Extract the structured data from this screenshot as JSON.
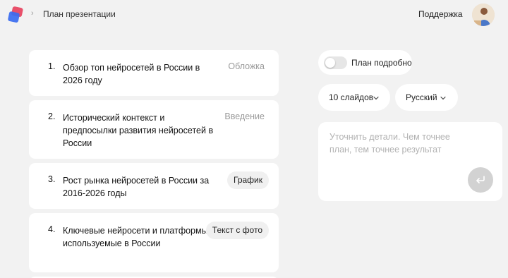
{
  "header": {
    "breadcrumb_separator": "›",
    "breadcrumb_title": "План презентации",
    "support_label": "Поддержка"
  },
  "slides": [
    {
      "number": "1.",
      "title": "Обзор топ нейросетей в России в 2026 году",
      "type": "Обложка",
      "type_style": "text"
    },
    {
      "number": "2.",
      "title": "Исторический контекст и предпосылки развития нейросетей в России",
      "type": "Введение",
      "type_style": "text"
    },
    {
      "number": "3.",
      "title": "Рост рынка нейросетей в России за 2016-2026 годы",
      "type": "График",
      "type_style": "pill"
    },
    {
      "number": "4.",
      "title": "Ключевые нейросети и платформы, используемые в России",
      "type": "Текст с фото",
      "type_style": "pill"
    }
  ],
  "settings": {
    "detailed_plan_label": "План подробно",
    "detailed_plan_on": false,
    "slides_count_label": "10 слайдов",
    "language_label": "Русский"
  },
  "refine": {
    "placeholder": "Уточнить детали. Чем точнее план, тем точнее результат",
    "value": ""
  },
  "colors": {
    "background": "#f2f2f2",
    "card": "#ffffff",
    "muted_text": "#9a9a9a",
    "logo_red": "#e8506a",
    "logo_blue": "#3b6cf0",
    "send_button": "#d2d2d2"
  },
  "icons": {
    "logo": "app-logo",
    "chevron": "chevron-down-icon",
    "send": "return-arrow-icon"
  }
}
